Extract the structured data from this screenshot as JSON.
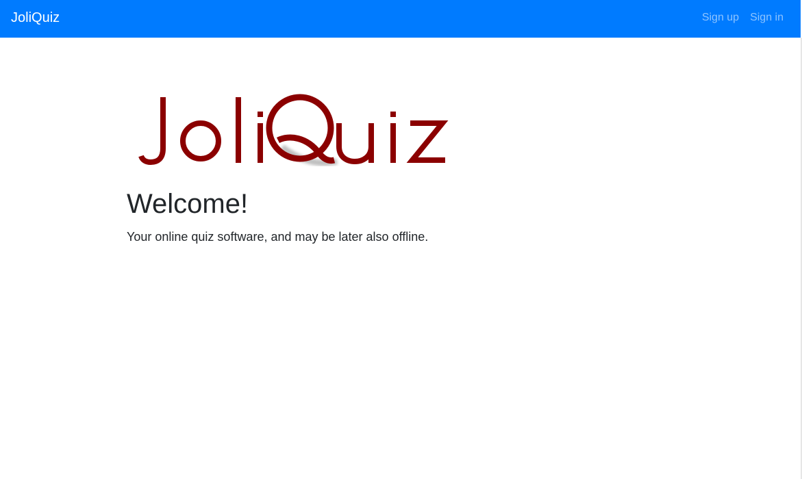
{
  "navbar": {
    "brand": "JoliQuiz",
    "links": [
      {
        "label": "Sign up"
      },
      {
        "label": "Sign in"
      }
    ],
    "background": "#007bff"
  },
  "logo": {
    "text": "JoliQuiz",
    "color": "#8b0000"
  },
  "hero": {
    "title": "Welcome!",
    "subtitle": "Your online quiz software, and may be later also offline."
  }
}
